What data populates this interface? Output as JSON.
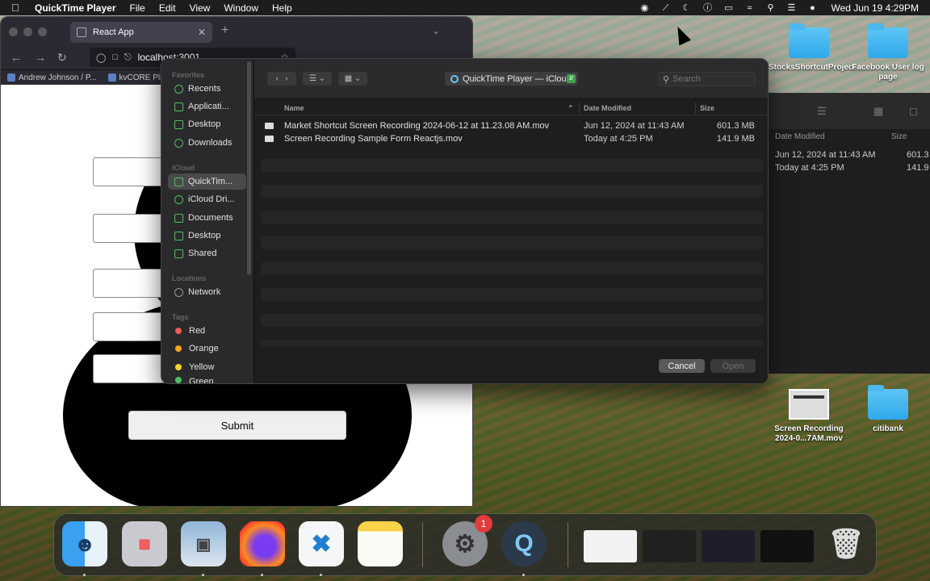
{
  "menubar": {
    "app_name": "QuickTime Player",
    "menus": [
      "File",
      "Edit",
      "View",
      "Window",
      "Help"
    ],
    "clock": "Wed Jun 19  4:29PM"
  },
  "browser": {
    "tab_title": "React App",
    "url": "localhost:3001",
    "bookmarks": [
      "Andrew Johnson / P...",
      "kvCORE Platf"
    ],
    "submit_label": "Submit"
  },
  "finder_behind": {
    "columns": [
      "Date Modified",
      "Size"
    ],
    "rows": [
      {
        "date": "Jun 12, 2024 at 11:43 AM",
        "size": "601.3"
      },
      {
        "date": "Today at 4:25 PM",
        "size": "141.9"
      }
    ]
  },
  "desktop": {
    "icons": [
      {
        "label": "StocksShortcutProject"
      },
      {
        "label": "Facebook User log page"
      },
      {
        "label": "Screen Recording 2024-0...7AM.mov"
      },
      {
        "label": "citibank"
      }
    ]
  },
  "dialog": {
    "sidebar": {
      "favorites_label": "Favorites",
      "favorites": [
        "Recents",
        "Applicati...",
        "Desktop",
        "Downloads"
      ],
      "icloud_label": "iCloud",
      "icloud": [
        "QuickTim...",
        "iCloud Dri...",
        "Documents",
        "Desktop",
        "Shared"
      ],
      "locations_label": "Locations",
      "locations": [
        "Network"
      ],
      "tags_label": "Tags",
      "tags": [
        {
          "label": "Red",
          "color": "#ec5b56"
        },
        {
          "label": "Orange",
          "color": "#f5a623"
        },
        {
          "label": "Yellow",
          "color": "#f7d32e"
        },
        {
          "label": "Green",
          "color": "#4fbf63"
        }
      ]
    },
    "location": "QuickTime Player — iCloud",
    "search_placeholder": "Search",
    "columns": {
      "name": "Name",
      "date": "Date Modified",
      "size": "Size"
    },
    "files": [
      {
        "name": "Market Shortcut Screen Recording 2024-06-12 at 11.23.08 AM.mov",
        "date": "Jun 12, 2024 at 11:43 AM",
        "size": "601.3 MB"
      },
      {
        "name": "Screen Recording Sample Form Reactjs.mov",
        "date": "Today at 4:25 PM",
        "size": "141.9 MB"
      }
    ],
    "cancel_label": "Cancel",
    "open_label": "Open"
  },
  "dock": {
    "apps": [
      "finder-icon",
      "launchpad-icon",
      "preview-icon",
      "firefox-icon",
      "vscode-icon",
      "notes-icon",
      "system-settings-icon",
      "quicktime-icon"
    ],
    "settings_badge": "1"
  }
}
